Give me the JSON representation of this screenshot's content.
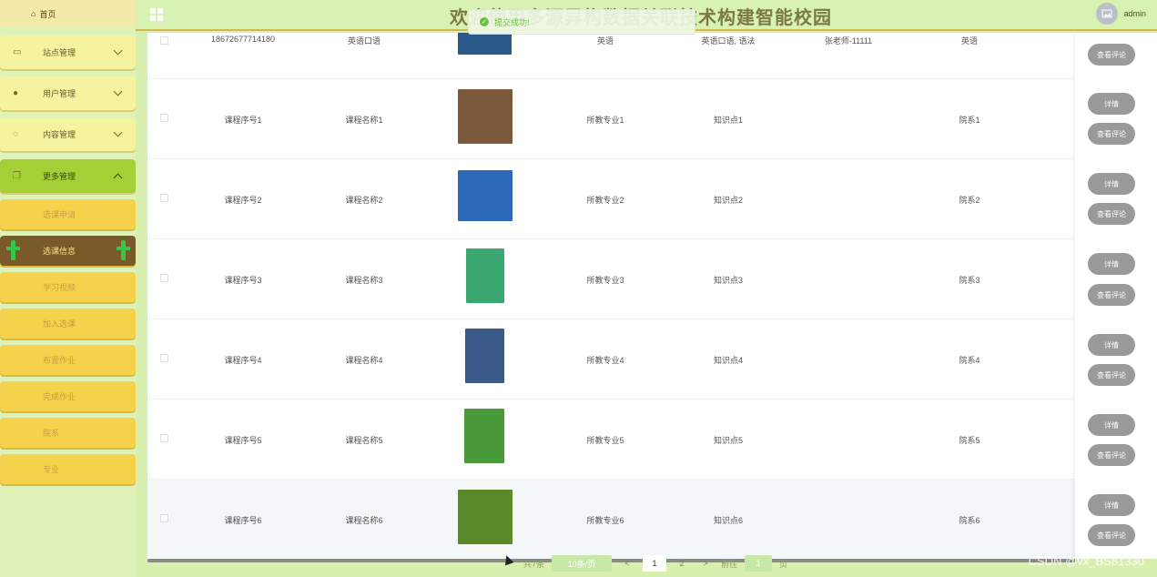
{
  "header": {
    "title": "欢迎使用多源异构数据关联技术构建智能校园",
    "username": "admin"
  },
  "toast": {
    "message": "提交成功!"
  },
  "sidebar": {
    "home": "首页",
    "menus": [
      {
        "label": "站点管理",
        "icon": "monitor-icon"
      },
      {
        "label": "用户管理",
        "icon": "user-icon"
      },
      {
        "label": "内容管理",
        "icon": "chat-icon"
      },
      {
        "label": "更多管理",
        "icon": "copy-icon"
      }
    ],
    "submenus": [
      "选课申请",
      "选课信息",
      "学习视频",
      "加入选课",
      "布置作业",
      "完成作业",
      "院系",
      "专业"
    ]
  },
  "table": {
    "rows": [
      {
        "course_no": "18672677714180",
        "course_name": "英语口语",
        "major": "英语",
        "knowledge": "英语口语, 语法",
        "teacher": "张老师-11111",
        "dept": "英语",
        "cover": "#2a5a8a"
      },
      {
        "course_no": "课程序号1",
        "course_name": "课程名称1",
        "major": "所教专业1",
        "knowledge": "知识点1",
        "teacher": "",
        "dept": "院系1",
        "cover": "#7a5a3a"
      },
      {
        "course_no": "课程序号2",
        "course_name": "课程名称2",
        "major": "所教专业2",
        "knowledge": "知识点2",
        "teacher": "",
        "dept": "院系2",
        "cover": "#2a6ab8"
      },
      {
        "course_no": "课程序号3",
        "course_name": "课程名称3",
        "major": "所教专业3",
        "knowledge": "知识点3",
        "teacher": "",
        "dept": "院系3",
        "cover": "#3aa870"
      },
      {
        "course_no": "课程序号4",
        "course_name": "课程名称4",
        "major": "所教专业4",
        "knowledge": "知识点4",
        "teacher": "",
        "dept": "院系4",
        "cover": "#3a5a8a"
      },
      {
        "course_no": "课程序号5",
        "course_name": "课程名称5",
        "major": "所教专业5",
        "knowledge": "知识点5",
        "teacher": "",
        "dept": "院系5",
        "cover": "#4a9a3a"
      },
      {
        "course_no": "课程序号6",
        "course_name": "课程名称6",
        "major": "所教专业6",
        "knowledge": "知识点6",
        "teacher": "",
        "dept": "院系6",
        "cover": "#5a8a2a"
      }
    ],
    "detail_label": "详情",
    "comment_label": "查看评论"
  },
  "pagination": {
    "total_text": "共7条",
    "page_size": "10条/页",
    "prev": "<",
    "page1": "1",
    "page2": "2",
    "next": ">",
    "goto_label": "前往",
    "goto_value": "1",
    "page_suffix": "页"
  },
  "watermark": "CSDN @vx_BS81330",
  "colors": {
    "sidebar_bg": "#dff3b8",
    "menu_bg": "#f6f3a0",
    "menu_open_bg": "#a5cf37",
    "submenu_bg": "#f5d24c",
    "submenu_active_bg": "#7b5a2a",
    "button_gray": "#9a9a9a"
  }
}
